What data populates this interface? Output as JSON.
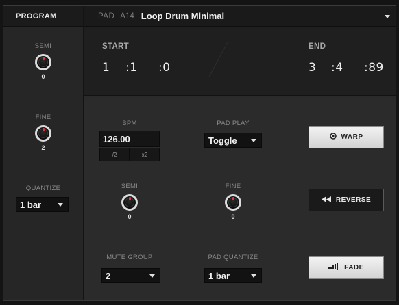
{
  "program": {
    "header": "PROGRAM",
    "semi": {
      "label": "SEMI",
      "value": "0"
    },
    "fine": {
      "label": "FINE",
      "value": "2"
    },
    "quantize": {
      "label": "QUANTIZE",
      "value": "1 bar"
    }
  },
  "pad_bar": {
    "pad_label": "PAD",
    "pad_number": "A14",
    "sample_name": "Loop Drum Minimal"
  },
  "range": {
    "start_label": "START",
    "start": {
      "bars": "1",
      "beats": ":1",
      "ticks": ":0"
    },
    "end_label": "END",
    "end": {
      "bars": "3",
      "beats": ":4",
      "ticks": ":89"
    }
  },
  "controls": {
    "bpm": {
      "label": "BPM",
      "value": "126.00",
      "half_label": "/2",
      "double_label": "x2"
    },
    "pad_play": {
      "label": "PAD PLAY",
      "value": "Toggle"
    },
    "semi": {
      "label": "SEMI",
      "value": "0"
    },
    "fine": {
      "label": "FINE",
      "value": "0"
    },
    "mute_group": {
      "label": "MUTE GROUP",
      "value": "2"
    },
    "pad_quantize": {
      "label": "PAD QUANTIZE",
      "value": "1 bar"
    }
  },
  "buttons": {
    "warp": "WARP",
    "reverse": "REVERSE",
    "fade": "FADE"
  },
  "icons": {
    "warp": "spiral-icon",
    "reverse": "rewind-icon",
    "fade": "fade-bars-icon",
    "dropdown": "chevron-down-icon"
  },
  "colors": {
    "knob_marker": "#d63a3a",
    "background": "#2b2b2b",
    "header": "#1a1a1a"
  }
}
